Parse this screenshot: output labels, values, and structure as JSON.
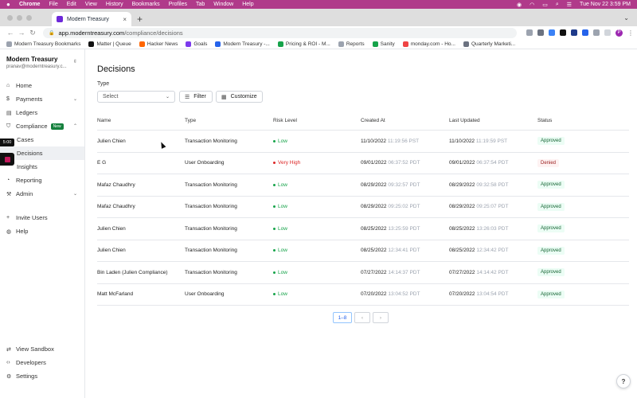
{
  "menubar": {
    "items": [
      "Chrome",
      "File",
      "Edit",
      "View",
      "History",
      "Bookmarks",
      "Profiles",
      "Tab",
      "Window",
      "Help"
    ],
    "datetime": "Tue Nov 22  3:59 PM"
  },
  "browser": {
    "tab_title": "Modern Treasury",
    "url_host": "app.moderntreasury.com",
    "url_path": "/compliance/decisions"
  },
  "bookmarks": [
    {
      "label": "Modern Treasury Bookmarks",
      "color": "#9ca3af"
    },
    {
      "label": "Matter | Queue",
      "color": "#111111"
    },
    {
      "label": "Hacker News",
      "color": "#ff6600"
    },
    {
      "label": "Goals",
      "color": "#7c3aed"
    },
    {
      "label": "Modern Treasury -...",
      "color": "#2563eb"
    },
    {
      "label": "Pricing & ROI - M...",
      "color": "#16a34a"
    },
    {
      "label": "Reports",
      "color": "#9ca3af"
    },
    {
      "label": "Sanity",
      "color": "#16a34a"
    },
    {
      "label": "monday.com - Ho...",
      "color": "#ef4444"
    },
    {
      "label": "Quarterly Marketi...",
      "color": "#6b7280"
    }
  ],
  "sidebar": {
    "org_name": "Modern Treasury",
    "org_email": "pranav@moderntreasury.c...",
    "timer": "5:00",
    "items": [
      {
        "label": "Home",
        "icon": "⌂"
      },
      {
        "label": "Payments",
        "icon": "$"
      },
      {
        "label": "Ledgers",
        "icon": "▤"
      },
      {
        "label": "Compliance",
        "icon": "⛉",
        "badge": "New"
      },
      {
        "label": "Cases"
      },
      {
        "label": "Decisions"
      },
      {
        "label": "Insights"
      },
      {
        "label": "Reporting",
        "icon": "◔"
      },
      {
        "label": "Admin",
        "icon": "⚒"
      },
      {
        "label": "Invite Users",
        "icon": "+"
      },
      {
        "label": "Help",
        "icon": "◍"
      }
    ],
    "bottom": [
      {
        "label": "View Sandbox",
        "icon": "⇄"
      },
      {
        "label": "Developers",
        "icon": "‹›"
      },
      {
        "label": "Settings",
        "icon": "⚙"
      }
    ]
  },
  "main": {
    "title": "Decisions",
    "type_label": "Type",
    "select_placeholder": "Select",
    "filter_label": "Filter",
    "customize_label": "Customize",
    "columns": [
      "Name",
      "Type",
      "Risk Level",
      "Created At",
      "Last Updated",
      "Status"
    ],
    "rows": [
      {
        "name": "Julien Chien",
        "type": "Transaction Monitoring",
        "risk": "Low",
        "created_date": "11/10/2022",
        "created_time": "11:19:56 PST",
        "updated_date": "11/10/2022",
        "updated_time": "11:19:59 PST",
        "status": "Approved"
      },
      {
        "name": "E G",
        "type": "User Onboarding",
        "risk": "Very High",
        "created_date": "09/01/2022",
        "created_time": "06:37:52 PDT",
        "updated_date": "09/01/2022",
        "updated_time": "06:37:54 PDT",
        "status": "Denied"
      },
      {
        "name": "Mafaz Chaudhry",
        "type": "Transaction Monitoring",
        "risk": "Low",
        "created_date": "08/29/2022",
        "created_time": "09:32:57 PDT",
        "updated_date": "08/29/2022",
        "updated_time": "09:32:58 PDT",
        "status": "Approved"
      },
      {
        "name": "Mafaz Chaudhry",
        "type": "Transaction Monitoring",
        "risk": "Low",
        "created_date": "08/29/2022",
        "created_time": "09:25:02 PDT",
        "updated_date": "08/29/2022",
        "updated_time": "09:25:07 PDT",
        "status": "Approved"
      },
      {
        "name": "Julien Chien",
        "type": "Transaction Monitoring",
        "risk": "Low",
        "created_date": "08/25/2022",
        "created_time": "13:25:59 PDT",
        "updated_date": "08/25/2022",
        "updated_time": "13:26:03 PDT",
        "status": "Approved"
      },
      {
        "name": "Julien Chien",
        "type": "Transaction Monitoring",
        "risk": "Low",
        "created_date": "08/25/2022",
        "created_time": "12:34:41 PDT",
        "updated_date": "08/25/2022",
        "updated_time": "12:34:42 PDT",
        "status": "Approved"
      },
      {
        "name": "Bin Laden (Julien Compliance)",
        "type": "Transaction Monitoring",
        "risk": "Low",
        "created_date": "07/27/2022",
        "created_time": "14:14:37 PDT",
        "updated_date": "07/27/2022",
        "updated_time": "14:14:42 PDT",
        "status": "Approved"
      },
      {
        "name": "Matt McFarland",
        "type": "User Onboarding",
        "risk": "Low",
        "created_date": "07/20/2022",
        "created_time": "13:04:52 PDT",
        "updated_date": "07/20/2022",
        "updated_time": "13:04:54 PDT",
        "status": "Approved"
      }
    ],
    "pagination": "1–8",
    "prev": "‹",
    "next": "›",
    "help": "?"
  },
  "colors": {
    "risk_low": "#16a34a",
    "risk_very_high": "#dc2626",
    "approved_bg": "#ecfdf5",
    "approved_fg": "#166534",
    "denied_bg": "#fef2f2",
    "denied_fg": "#991b1b"
  }
}
